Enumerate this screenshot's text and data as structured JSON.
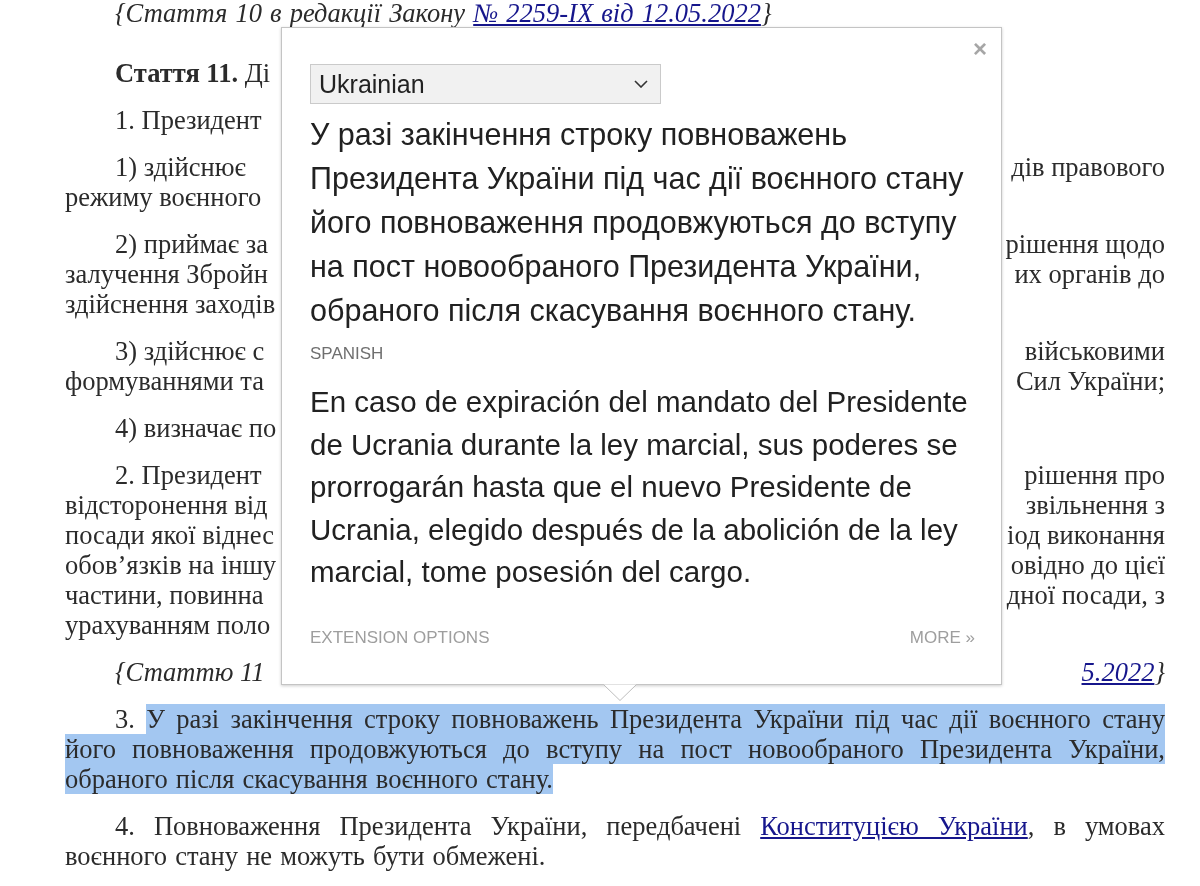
{
  "document": {
    "paragraphs": [
      {
        "kind": "note",
        "parts": [
          {
            "kind": "plain",
            "text": "{Стаття 10 в редакції Закону "
          },
          {
            "kind": "link",
            "text": "№ 2259-IX від 12.05.2022"
          },
          {
            "kind": "plain",
            "text": "}"
          }
        ]
      },
      {
        "kind": "heading",
        "lines": [
          {
            "left": [
              {
                "kind": "plain",
                "text": "**Стаття 11.** Ді"
              }
            ]
          }
        ]
      },
      {
        "kind": "item",
        "lines": [
          {
            "left": [
              {
                "kind": "plain",
                "text": "1. Президент"
              }
            ]
          }
        ]
      },
      {
        "kind": "item",
        "lines": [
          {
            "left": [
              {
                "kind": "plain",
                "text": "1) здійснює"
              }
            ],
            "right": [
              {
                "kind": "plain",
                "text": "дів правового"
              }
            ]
          },
          {
            "left": [
              {
                "kind": "plain",
                "text": "режиму воєнного"
              }
            ]
          }
        ]
      },
      {
        "kind": "item",
        "lines": [
          {
            "left": [
              {
                "kind": "plain",
                "text": "2) приймає за"
              }
            ],
            "right": [
              {
                "kind": "plain",
                "text": "рішення щодо"
              }
            ]
          },
          {
            "left": [
              {
                "kind": "plain",
                "text": "залучення Збройн"
              }
            ],
            "right": [
              {
                "kind": "plain",
                "text": "их органів до"
              }
            ]
          },
          {
            "left": [
              {
                "kind": "plain",
                "text": "здійснення заходів"
              }
            ]
          }
        ]
      },
      {
        "kind": "item",
        "lines": [
          {
            "left": [
              {
                "kind": "plain",
                "text": "3) здійснює с"
              }
            ],
            "right": [
              {
                "kind": "plain",
                "text": "військовими"
              }
            ]
          },
          {
            "left": [
              {
                "kind": "plain",
                "text": "формуваннями та"
              }
            ],
            "right": [
              {
                "kind": "plain",
                "text": "Сил України;"
              }
            ]
          }
        ]
      },
      {
        "kind": "item",
        "lines": [
          {
            "left": [
              {
                "kind": "plain",
                "text": "4) визначає по"
              }
            ]
          }
        ]
      },
      {
        "kind": "item",
        "lines": [
          {
            "left": [
              {
                "kind": "plain",
                "text": "2. Президент"
              }
            ],
            "right": [
              {
                "kind": "plain",
                "text": "рішення про"
              }
            ]
          },
          {
            "left": [
              {
                "kind": "plain",
                "text": "відсторонення від"
              }
            ],
            "right": [
              {
                "kind": "plain",
                "text": "звільнення з"
              }
            ]
          },
          {
            "left": [
              {
                "kind": "plain",
                "text": "посади якої віднес"
              }
            ],
            "right": [
              {
                "kind": "plain",
                "text": "іод виконання"
              }
            ]
          },
          {
            "left": [
              {
                "kind": "plain",
                "text": "обов’язків на іншу"
              }
            ],
            "right": [
              {
                "kind": "plain",
                "text": "овідно до цієї"
              }
            ]
          },
          {
            "left": [
              {
                "kind": "plain",
                "text": "частини, повинна"
              }
            ],
            "right": [
              {
                "kind": "plain",
                "text": "дної посади, з"
              }
            ]
          },
          {
            "left": [
              {
                "kind": "plain",
                "text": "урахуванням поло"
              }
            ]
          }
        ]
      },
      {
        "kind": "note",
        "lines": [
          {
            "left": [
              {
                "kind": "plain",
                "text": "{Статтю 11"
              }
            ],
            "right": [
              {
                "kind": "link",
                "text": "5.2022"
              },
              {
                "kind": "plain",
                "text": "}"
              }
            ]
          }
        ]
      },
      {
        "kind": "item",
        "parts": [
          {
            "kind": "plain",
            "text": "3. "
          },
          {
            "kind": "selection",
            "text": "У разі закінчення строку повноважень Президента України під час дії воєнного стану його повноваження продовжуються до вступу на пост новообраного Президента України, обраного після скасування воєнного стану."
          }
        ]
      },
      {
        "kind": "item",
        "parts": [
          {
            "kind": "plain",
            "text": "4. Повноваження Президента України, передбачені "
          },
          {
            "kind": "link",
            "text": "Конституцією України"
          },
          {
            "kind": "plain",
            "text": ", в умовах воєнного стану не можуть бути обмежені."
          }
        ]
      }
    ]
  },
  "popup": {
    "close": "×",
    "language_select": {
      "value": "Ukrainian"
    },
    "source_text": "У разі закінчення строку повноважень Президента України під час дії воєнного стану його повноваження продовжуються до вступу на пост новообраного Президента України, обраного після скасування воєнного стану.",
    "target_language": "SPANISH",
    "translation": "En caso de expiración del mandato del Presidente de Ucrania durante la ley marcial, sus poderes se prorrogarán hasta que el nuevo Presidente de Ucrania, elegido después de la abolición de la ley marcial, tome posesión del cargo.",
    "footer": {
      "options": "EXTENSION OPTIONS",
      "more": "MORE »"
    }
  }
}
